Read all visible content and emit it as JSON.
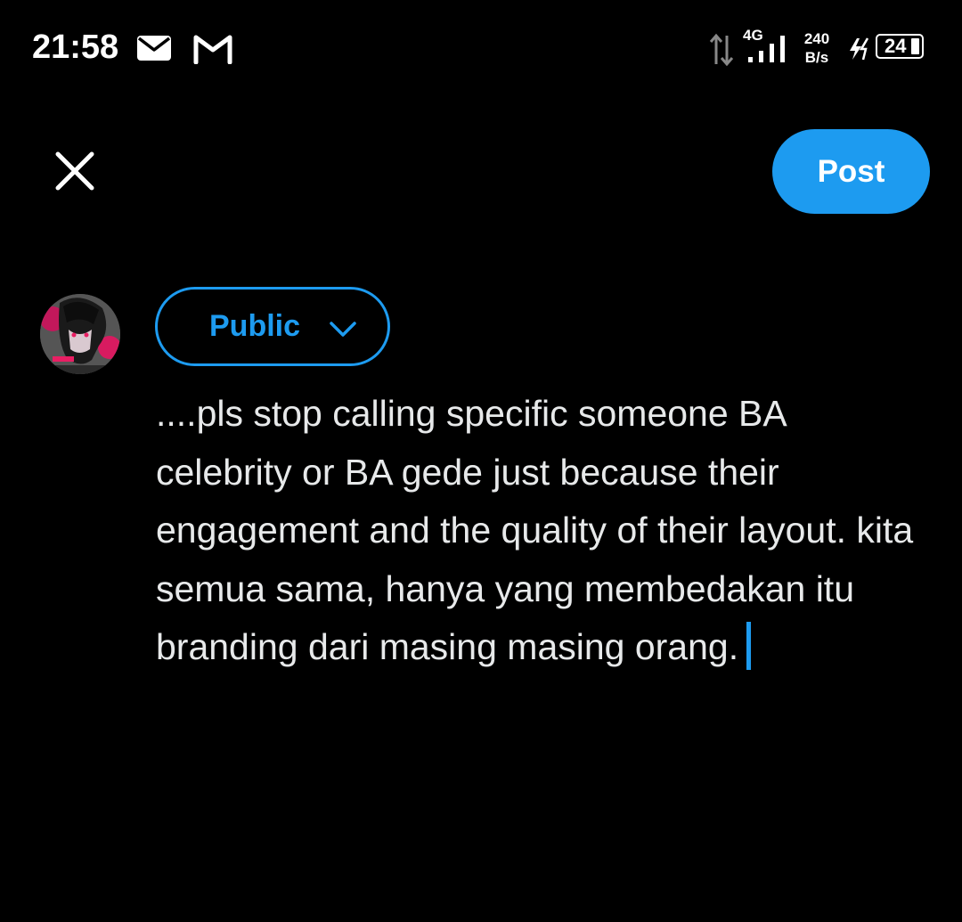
{
  "status_bar": {
    "time": "21:58",
    "notification_icons": [
      "mail-icon",
      "gmail-icon"
    ],
    "network_type": "4G",
    "speed_value": "240",
    "speed_unit": "B/s",
    "battery_level": "24"
  },
  "top_bar": {
    "close_icon": "close-icon",
    "post_label": "Post"
  },
  "composer": {
    "audience_label": "Public",
    "text": "....pls stop calling specific someone BA celebrity or BA gede just because their engagement and the quality of their layout. kita semua sama, hanya yang membedakan itu branding dari masing masing orang."
  },
  "colors": {
    "accent": "#1d9bf0",
    "background": "#000000",
    "text": "#e7e9ea"
  }
}
